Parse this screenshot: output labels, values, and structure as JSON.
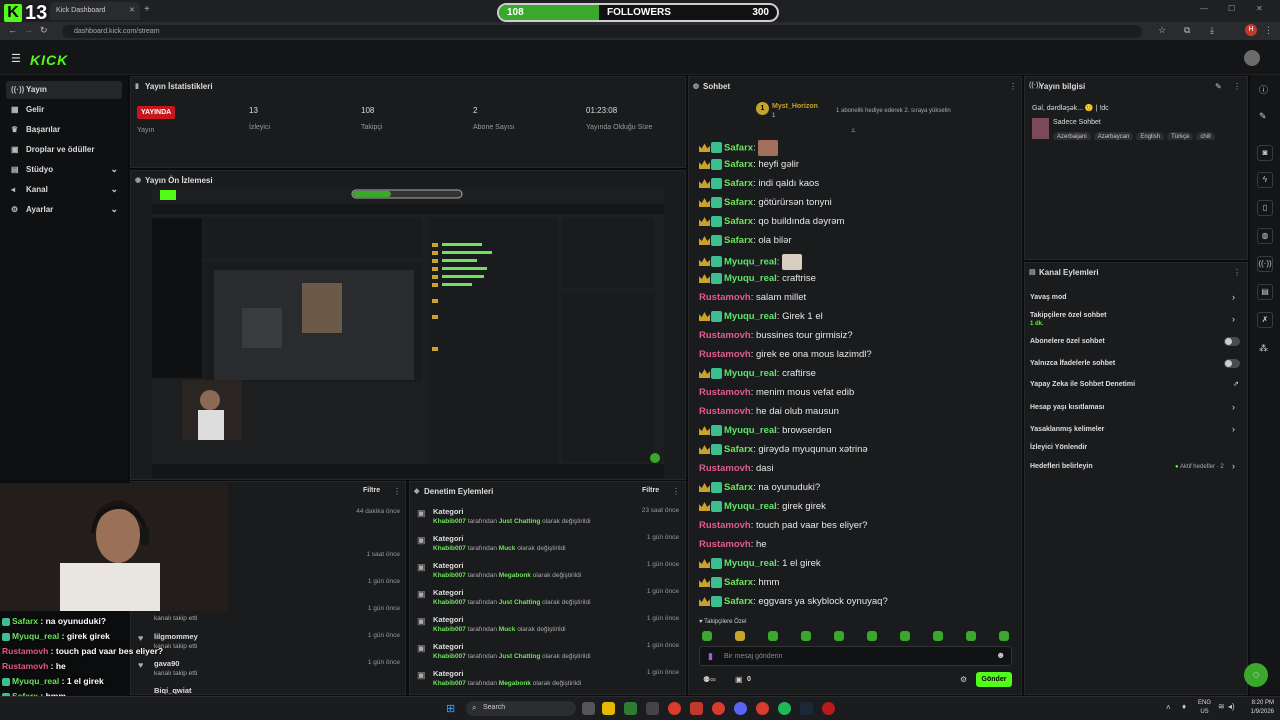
{
  "browser": {
    "tab_title": "Kick Dashboard",
    "url": "dashboard.kick.com/stream",
    "avatar_letter": "H"
  },
  "overlay": {
    "viewer_count": "13",
    "followers_current": "108",
    "followers_label": "FOLLOWERS",
    "followers_goal": "300",
    "followers_progress": 0.36
  },
  "header": {
    "brand": "KICK"
  },
  "sidebar": {
    "items": [
      {
        "label": "Yayın",
        "icon": "broadcast-icon"
      },
      {
        "label": "Gelir",
        "icon": "revenue-icon"
      },
      {
        "label": "Başarılar",
        "icon": "trophy-icon"
      },
      {
        "label": "Droplar ve ödüller",
        "icon": "gift-icon"
      },
      {
        "label": "Stüdyo",
        "icon": "studio-icon"
      },
      {
        "label": "Kanal",
        "icon": "channel-icon"
      },
      {
        "label": "Ayarlar",
        "icon": "settings-icon"
      }
    ]
  },
  "stats": {
    "title": "Yayın İstatistikleri",
    "live_badge": "YAYINDA",
    "items": [
      {
        "label": "Yayın",
        "value": ""
      },
      {
        "label": "İzleyici",
        "value": "13"
      },
      {
        "label": "Takipçi",
        "value": "108"
      },
      {
        "label": "Abone Sayısı",
        "value": "2"
      },
      {
        "label": "Yayında Olduğu Süre",
        "value": "01:23:08"
      }
    ]
  },
  "preview": {
    "title": "Yayın Ön İzlemesi"
  },
  "chat": {
    "title": "Sohbet",
    "pinned_user": "Myst_Horizon",
    "pinned_count": "1",
    "pinned_text": "1 abonelik hediye ederek 2. sıraya yükselin",
    "messages": [
      {
        "user": "Safarx",
        "text": "",
        "emote": true
      },
      {
        "user": "Safarx",
        "text": "heyfi gəlir"
      },
      {
        "user": "Safarx",
        "text": "indi qaldı kaos"
      },
      {
        "user": "Safarx",
        "text": "götürürsən tonyni"
      },
      {
        "user": "Safarx",
        "text": "qo buildında dəyrəm"
      },
      {
        "user": "Safarx",
        "text": "ola bilər"
      },
      {
        "user": "Myuqu_real",
        "text": "",
        "emote": true
      },
      {
        "user": "Myuqu_real",
        "text": "craftrise"
      },
      {
        "user": "Rustamovh",
        "text": "salam millet"
      },
      {
        "user": "Myuqu_real",
        "text": "Girek 1 el"
      },
      {
        "user": "Rustamovh",
        "text": "bussines tour girmisiz?"
      },
      {
        "user": "Rustamovh",
        "text": "girek ee ona mous lazimdl?"
      },
      {
        "user": "Myuqu_real",
        "text": "craftirse"
      },
      {
        "user": "Rustamovh",
        "text": "menim mous vefat edib"
      },
      {
        "user": "Rustamovh",
        "text": "he dai olub mausun"
      },
      {
        "user": "Myuqu_real",
        "text": "browserden"
      },
      {
        "user": "Safarx",
        "text": "girəydə myuqunun xətrinə"
      },
      {
        "user": "Rustamovh",
        "text": "dasi"
      },
      {
        "user": "Safarx",
        "text": "na oyunuduki?"
      },
      {
        "user": "Myuqu_real",
        "text": "girek girek"
      },
      {
        "user": "Rustamovh",
        "text": "touch pad vaar bes eliyer?"
      },
      {
        "user": "Rustamovh",
        "text": "he"
      },
      {
        "user": "Myuqu_real",
        "text": "1 el girek"
      },
      {
        "user": "Safarx",
        "text": "hmm"
      },
      {
        "user": "Safarx",
        "text": "eggvars ya skyblock oynuyaq?"
      }
    ],
    "mode_label": "Takipçilere Özel",
    "input_placeholder": "Bir mesaj gönderin",
    "points": "0",
    "send_label": "Gönder"
  },
  "stream_info": {
    "title": "Yayın bilgisi",
    "stream_title": "Gəl, dərdləşək... 🙂 | !dc",
    "category": "Sadece Sohbet",
    "tags": [
      "Azerbaijani",
      "Azərbaycan",
      "English",
      "Türkçe",
      "chill"
    ]
  },
  "channel_actions": {
    "title": "Kanal Eylemleri",
    "items": [
      {
        "label": "Yavaş mod",
        "control": "chevron"
      },
      {
        "label": "Takipçilere özel sohbet",
        "sub": "1 dk.",
        "control": "chevron"
      },
      {
        "label": "Abonelere özel sohbet",
        "control": "toggle"
      },
      {
        "label": "Yalnızca İfadelerle sohbet",
        "control": "toggle"
      },
      {
        "label": "Yapay Zeka ile Sohbet Denetimi",
        "control": "external"
      },
      {
        "label": "Hesap yaşı kısıtlaması",
        "control": "chevron"
      },
      {
        "label": "Yasaklanmış kelimeler",
        "control": "chevron"
      },
      {
        "label": "İzleyici Yönlendir",
        "control": "none"
      },
      {
        "label": "Hedefleri belirleyin",
        "extra": "Aktif hedefler · 2",
        "control": "chevron"
      }
    ]
  },
  "activity": {
    "filter_label": "Filtre",
    "items": [
      {
        "time": "44 dakika önce"
      },
      {
        "time": "1 saat önce"
      },
      {
        "time": "1 gün önce"
      },
      {
        "time": "1 gün önce",
        "sub": "kanalı takip etti"
      },
      {
        "name": "lilgmommey",
        "sub": "kanalı takip etti",
        "time": "1 gün önce"
      },
      {
        "name": "gava90",
        "sub": "kanalı takip etti",
        "time": "1 gün önce"
      },
      {
        "name": "Biqi_qwiat",
        "time": ""
      }
    ]
  },
  "moderation": {
    "title": "Denetim Eylemleri",
    "filter_label": "Filtre",
    "items": [
      {
        "title": "Kategori",
        "mod": "Khabib007",
        "mid": "tarafından",
        "category": "Just Chatting",
        "end": "olarak değiştirildi",
        "time": "23 saat önce"
      },
      {
        "title": "Kategori",
        "mod": "Khabib007",
        "mid": "tarafından",
        "category": "Muck",
        "end": "olarak değiştirildi",
        "time": "1 gün önce"
      },
      {
        "title": "Kategori",
        "mod": "Khabib007",
        "mid": "tarafından",
        "category": "Megabonk",
        "end": "olarak değiştirildi",
        "time": "1 gün önce"
      },
      {
        "title": "Kategori",
        "mod": "Khabib007",
        "mid": "tarafından",
        "category": "Just Chatting",
        "end": "olarak değiştirildi",
        "time": "1 gün önce"
      },
      {
        "title": "Kategori",
        "mod": "Khabib007",
        "mid": "tarafından",
        "category": "Muck",
        "end": "olarak değiştirildi",
        "time": "1 gün önce"
      },
      {
        "title": "Kategori",
        "mod": "Khabib007",
        "mid": "tarafından",
        "category": "Just Chatting",
        "end": "olarak değiştirildi",
        "time": "1 gün önce"
      },
      {
        "title": "Kategori",
        "mod": "Khabib007",
        "mid": "tarafından",
        "category": "Megabonk",
        "end": "olarak değiştirildi",
        "time": "1 gün önce"
      }
    ]
  },
  "overlay_chat": [
    {
      "user": "Safarx",
      "text": "na oyunuduki?"
    },
    {
      "user": "Myuqu_real",
      "text": "girek girek"
    },
    {
      "user": "Rustamovh",
      "text": "touch pad vaar bes eliyer?"
    },
    {
      "user": "Rustamovh",
      "text": "he"
    },
    {
      "user": "Myuqu_real",
      "text": "1 el girek"
    },
    {
      "user": "Safarx",
      "text": "hmm"
    },
    {
      "user": "Safarx",
      "text": "eggvars ya skyblock oynuyaq?"
    }
  ],
  "taskbar": {
    "search_placeholder": "Search",
    "lang": "ENG",
    "region": "US",
    "time": "8:20 PM",
    "date": "1/9/2026"
  },
  "colors": {
    "accent": "#53fc18",
    "safarx": "#6de35b",
    "rustamovh": "#e45a8a",
    "live": "#c5171c"
  }
}
